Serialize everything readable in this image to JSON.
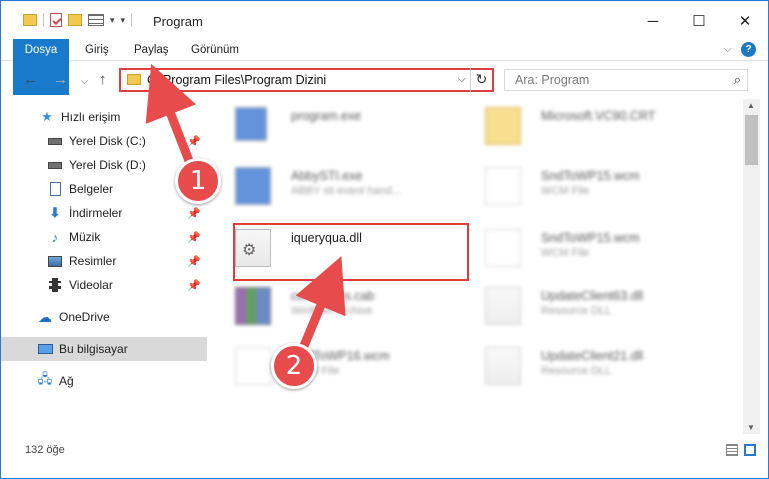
{
  "window": {
    "title": "Program"
  },
  "ribbon": {
    "tabs": [
      "Dosya",
      "Giriş",
      "Paylaş",
      "Görünüm"
    ]
  },
  "address": {
    "path": "C:\\Program Files\\Program Dizini"
  },
  "search": {
    "placeholder": "Ara: Program"
  },
  "sidebar": {
    "items": [
      {
        "label": "Hızlı erişim",
        "icon": "star-icon"
      },
      {
        "label": "Yerel Disk (C:)",
        "icon": "drive-icon"
      },
      {
        "label": "Yerel Disk (D:)",
        "icon": "drive-icon"
      },
      {
        "label": "Belgeler",
        "icon": "documents-icon"
      },
      {
        "label": "İndirmeler",
        "icon": "download-icon"
      },
      {
        "label": "Müzik",
        "icon": "music-icon"
      },
      {
        "label": "Resimler",
        "icon": "pictures-icon"
      },
      {
        "label": "Videolar",
        "icon": "video-icon"
      },
      {
        "label": "OneDrive",
        "icon": "cloud-icon"
      },
      {
        "label": "Bu bilgisayar",
        "icon": "computer-icon"
      },
      {
        "label": "Ağ",
        "icon": "network-icon"
      }
    ]
  },
  "files": [
    {
      "name": "program.exe",
      "sub": ""
    },
    {
      "name": "Microsoft.VC90.CRT",
      "sub": ""
    },
    {
      "name": "AbbySTI.exe",
      "sub": "ABBY sti event hand..."
    },
    {
      "name": "SndToWP15.wcm",
      "sub": "WCM File"
    },
    {
      "name": "iqueryqua.dll",
      "sub": ""
    },
    {
      "name": "SndToWP15.wcm",
      "sub": "WCM File"
    },
    {
      "name": "certificates.cab",
      "sub": "WinRAR Archive"
    },
    {
      "name": "UpdateClient63.dll",
      "sub": "Resource DLL"
    },
    {
      "name": "SndToWP16.wcm",
      "sub": "WCM File"
    },
    {
      "name": "UpdateClient21.dll",
      "sub": "Resource DLL"
    }
  ],
  "status": {
    "count": "132 öğe"
  },
  "annotations": {
    "one": "1",
    "two": "2",
    "color": "#e84b4b"
  }
}
